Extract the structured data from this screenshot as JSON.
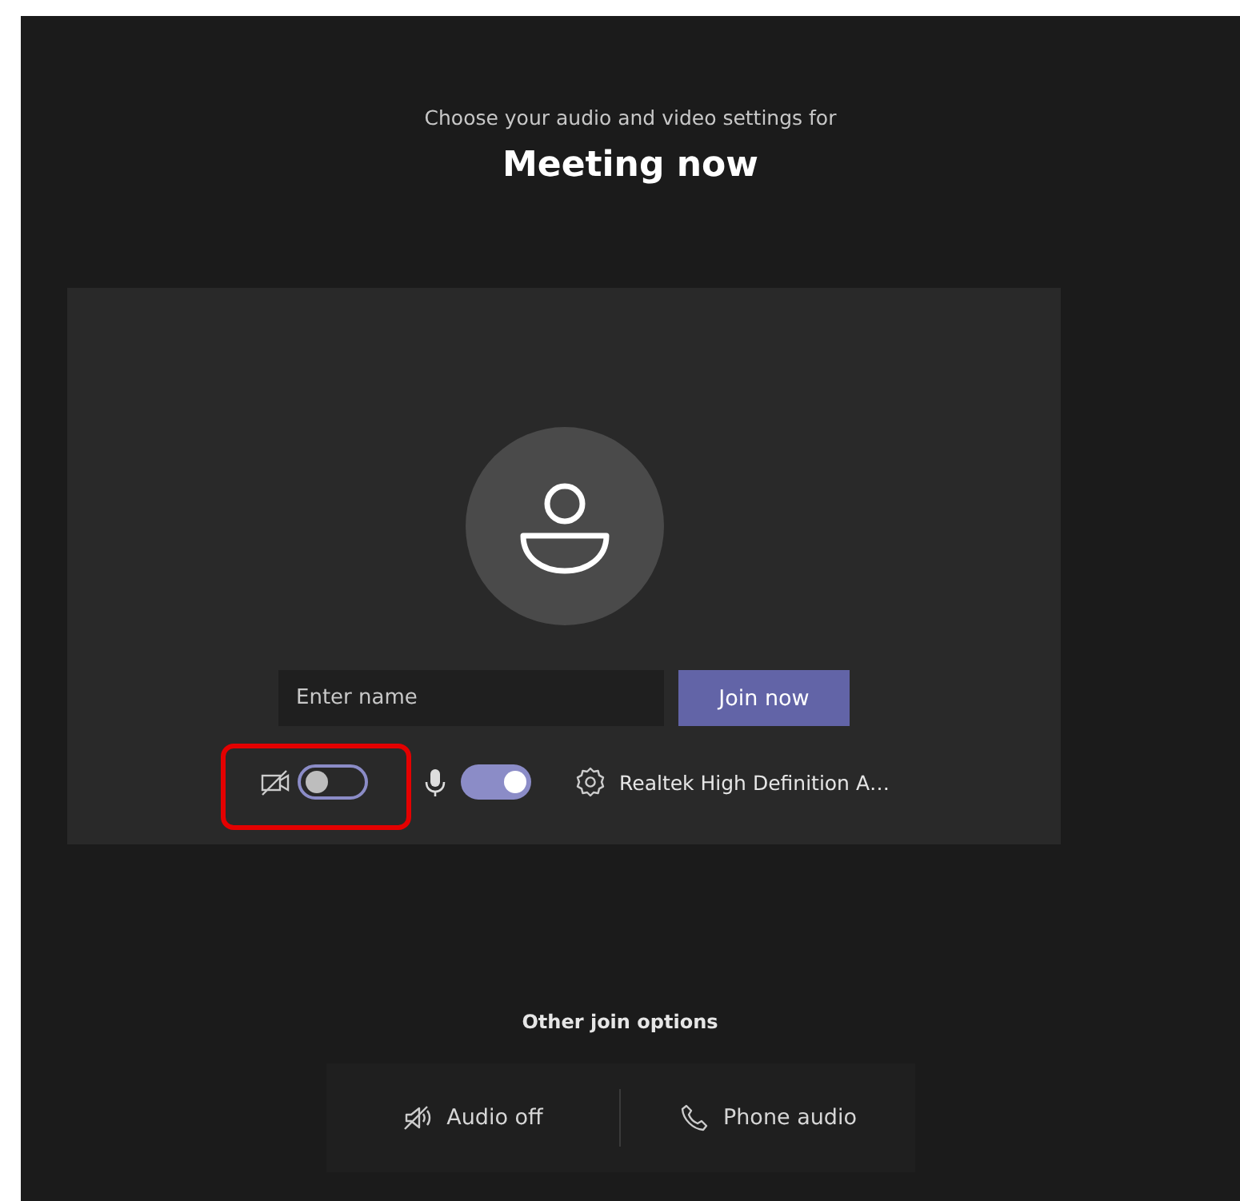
{
  "header": {
    "subtitle": "Choose your audio and video settings for",
    "title": "Meeting now"
  },
  "preview": {
    "name_field": {
      "placeholder": "Enter name"
    },
    "join_button": "Join now",
    "camera": {
      "on": false,
      "highlighted": true
    },
    "microphone": {
      "on": true
    },
    "device": "Realtek High Definition A…"
  },
  "other_options": {
    "title": "Other join options",
    "items": [
      {
        "kind": "audio_off",
        "label": "Audio off"
      },
      {
        "kind": "phone",
        "label": "Phone audio"
      }
    ]
  }
}
